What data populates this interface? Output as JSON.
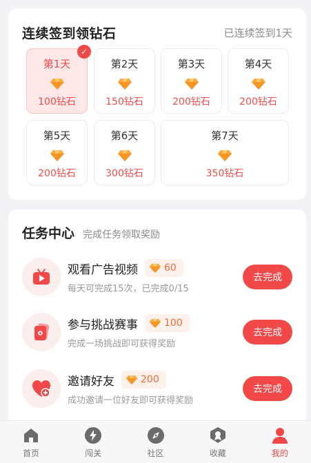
{
  "checkin": {
    "title": "连续签到领钻石",
    "status": "已连续签到1天",
    "days": [
      {
        "label": "第1天",
        "reward": "100钻石",
        "checked": true
      },
      {
        "label": "第2天",
        "reward": "150钻石",
        "checked": false
      },
      {
        "label": "第3天",
        "reward": "200钻石",
        "checked": false
      },
      {
        "label": "第4天",
        "reward": "200钻石",
        "checked": false
      },
      {
        "label": "第5天",
        "reward": "200钻石",
        "checked": false
      },
      {
        "label": "第6天",
        "reward": "300钻石",
        "checked": false
      },
      {
        "label": "第7天",
        "reward": "350钻石",
        "checked": false
      }
    ],
    "check_mark": "✓"
  },
  "tasks": {
    "title": "任务中心",
    "subtitle": "完成任务领取奖励",
    "items": [
      {
        "name": "观看广告视频",
        "reward": "60",
        "desc": "每天可完成15次，已完成0/15",
        "button": "去完成",
        "icon": "video-play-icon"
      },
      {
        "name": "参与挑战赛事",
        "reward": "100",
        "desc": "完成一场挑战即可获得奖励",
        "button": "去完成",
        "icon": "challenge-card-icon"
      },
      {
        "name": "邀请好友",
        "reward": "200",
        "desc": "成功邀请一位好友即可获得奖励",
        "button": "去完成",
        "icon": "heart-plus-icon"
      }
    ]
  },
  "nav": {
    "items": [
      {
        "label": "首页",
        "icon": "home-icon",
        "active": false
      },
      {
        "label": "闯关",
        "icon": "lightning-icon",
        "active": false
      },
      {
        "label": "社区",
        "icon": "compass-icon",
        "active": false
      },
      {
        "label": "收藏",
        "icon": "badge-icon",
        "active": false
      },
      {
        "label": "我的",
        "icon": "user-icon",
        "active": true
      }
    ]
  },
  "colors": {
    "accent": "#f24848",
    "gem": "#f7a93a",
    "background": "#f3f3f5"
  }
}
